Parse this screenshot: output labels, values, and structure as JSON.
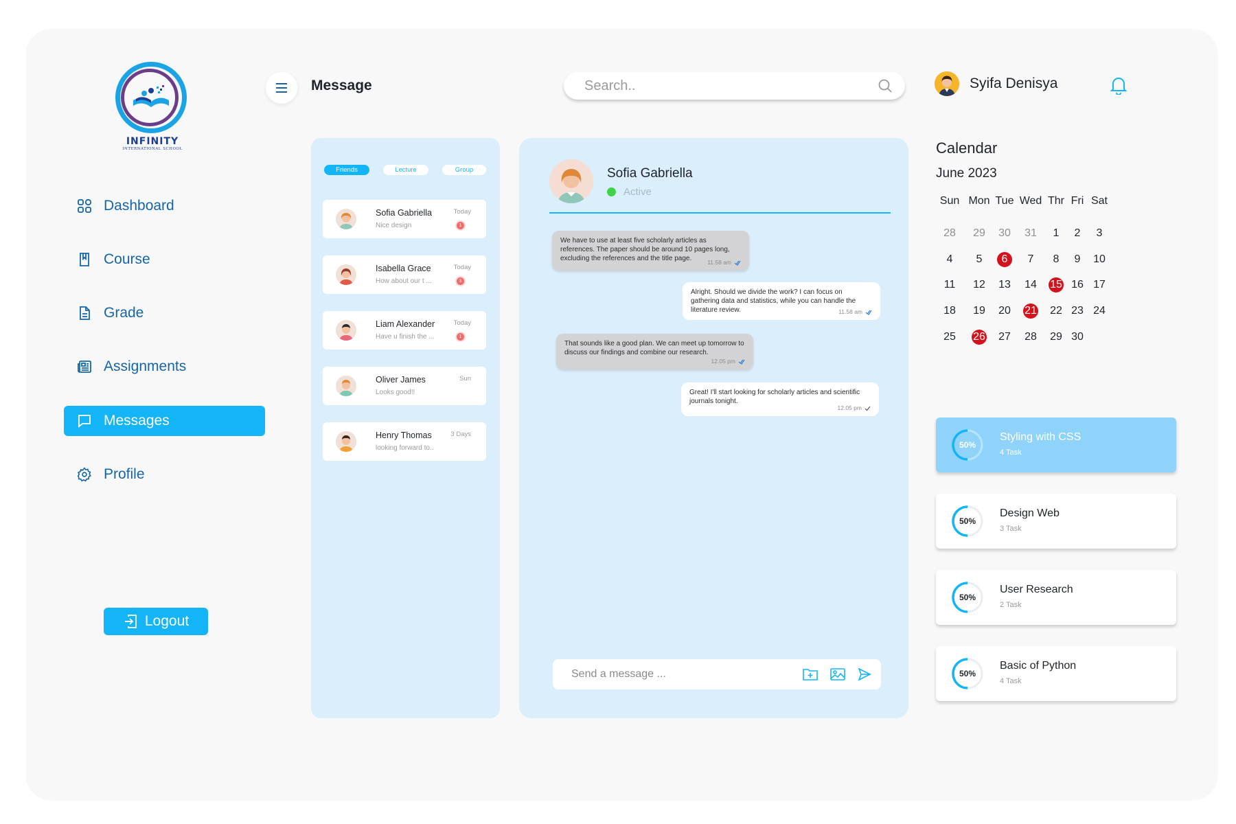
{
  "brand": {
    "name": "INFINITY",
    "subtitle": "INTERNATIONAL SCHOOL"
  },
  "sidebar": {
    "items": [
      {
        "label": "Dashboard",
        "icon": "grid-icon",
        "active": false
      },
      {
        "label": "Course",
        "icon": "book-icon",
        "active": false
      },
      {
        "label": "Grade",
        "icon": "document-icon",
        "active": false
      },
      {
        "label": "Assignments",
        "icon": "newspaper-icon",
        "active": false
      },
      {
        "label": "Messages",
        "icon": "chat-icon",
        "active": true
      },
      {
        "label": "Profile",
        "icon": "gear-icon",
        "active": false
      }
    ],
    "logout_label": "Logout"
  },
  "header": {
    "title": "Message",
    "search_placeholder": "Search..",
    "user_name": "Syifa Denisya"
  },
  "contacts": {
    "tabs": [
      "Friends",
      "Lecture",
      "Group"
    ],
    "active_tab": "Friends",
    "list": [
      {
        "name": "Sofia Gabriella",
        "preview": "Nice design",
        "time": "Today",
        "unread": "1"
      },
      {
        "name": "Isabella Grace",
        "preview": "How about our t ...",
        "time": "Today",
        "unread": "3"
      },
      {
        "name": "Liam Alexander",
        "preview": "Have u finish the ...",
        "time": "Today",
        "unread": "1"
      },
      {
        "name": "Oliver James",
        "preview": "Looks good!!",
        "time": "Sun",
        "unread": ""
      },
      {
        "name": "Henry Thomas",
        "preview": "looking forward to..",
        "time": "3 Days",
        "unread": ""
      }
    ]
  },
  "chat": {
    "contact_name": "Sofia Gabriella",
    "status": "Active",
    "messages": [
      {
        "direction": "in",
        "text": "We have to use at least five scholarly articles as references. The paper should be around 10 pages long, excluding the references and the title page.",
        "time": "11.58 am"
      },
      {
        "direction": "out",
        "text": "Alright. Should we divide the work? I can focus on gathering data and statistics, while you can handle the literature review.",
        "time": "11.58 am"
      },
      {
        "direction": "in",
        "text": "That sounds like a good plan. We can meet up tomorrow to discuss our findings and combine our research.",
        "time": "12.05 pm"
      },
      {
        "direction": "out",
        "text": "Great! I'll start looking for scholarly articles and scientific journals tonight.",
        "time": "12.05 pm"
      }
    ],
    "composer_placeholder": "Send a message ..."
  },
  "calendar": {
    "title": "Calendar",
    "month": "June 2023",
    "weekdays": [
      "Sun",
      "Mon",
      "Tue",
      "Wed",
      "Thr",
      "Fri",
      "Sat"
    ],
    "weeks": [
      [
        "28",
        "29",
        "30",
        "31",
        "1",
        "2",
        "3"
      ],
      [
        "4",
        "5",
        "6",
        "7",
        "8",
        "9",
        "10"
      ],
      [
        "11",
        "12",
        "13",
        "14",
        "15",
        "16",
        "17"
      ],
      [
        "18",
        "19",
        "20",
        "21",
        "22",
        "23",
        "24"
      ],
      [
        "25",
        "26",
        "27",
        "28",
        "29",
        "30"
      ]
    ],
    "muted": [
      "28",
      "29",
      "30",
      "31"
    ],
    "marked_days": [
      "6",
      "15",
      "21",
      "26"
    ],
    "marked_color": "#d3121b"
  },
  "courses": [
    {
      "title": "Styling with CSS",
      "tasks": "4 Task",
      "progress_label": "50%",
      "progress": 0.5,
      "highlight": true
    },
    {
      "title": "Design Web",
      "tasks": "3 Task",
      "progress_label": "50%",
      "progress": 0.5,
      "highlight": false
    },
    {
      "title": "User Research",
      "tasks": "2 Task",
      "progress_label": "50%",
      "progress": 0.5,
      "highlight": false
    },
    {
      "title": "Basic of Python",
      "tasks": "4 Task",
      "progress_label": "50%",
      "progress": 0.5,
      "highlight": false
    }
  ],
  "colors": {
    "accent": "#13b5f6",
    "panel": "#dbeefb",
    "nav_text": "#1565a6",
    "badge": "#f26b6b",
    "online": "#3ed34a"
  }
}
